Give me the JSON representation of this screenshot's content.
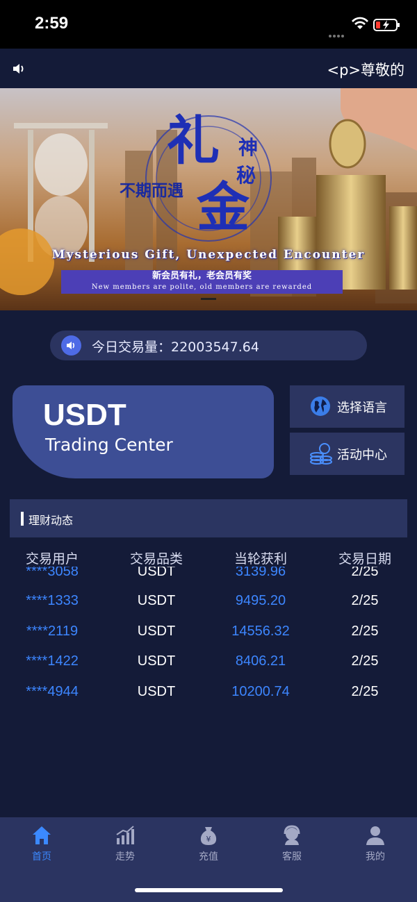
{
  "status_bar": {
    "time": "2:59"
  },
  "notice": {
    "marquee_text": "<p>尊敬的"
  },
  "banner": {
    "heading_cn_small": "不期而遇",
    "heading_cn_li": "礼",
    "heading_cn_shen": "神",
    "heading_cn_mi": "秘",
    "heading_cn_jin": "金",
    "slogan_en": "Mysterious Gift, Unexpected Encounter",
    "strip_cn": "新会员有礼，老会员有奖",
    "strip_en": "New members are polite, old members are rewarded"
  },
  "volume": {
    "label": "今日交易量：22003547.64"
  },
  "card": {
    "title": "USDT",
    "subtitle": "Trading Center"
  },
  "side_buttons": {
    "language": "选择语言",
    "activity": "活动中心"
  },
  "section": {
    "title": "理财动态"
  },
  "table": {
    "headers": [
      "交易用户",
      "交易品类",
      "当轮获利",
      "交易日期"
    ],
    "rows": [
      {
        "user": "****3058",
        "coin": "USDT",
        "profit": "3139.96",
        "date": "2/25"
      },
      {
        "user": "****1333",
        "coin": "USDT",
        "profit": "9495.20",
        "date": "2/25"
      },
      {
        "user": "****2119",
        "coin": "USDT",
        "profit": "14556.32",
        "date": "2/25"
      },
      {
        "user": "****1422",
        "coin": "USDT",
        "profit": "8406.21",
        "date": "2/25"
      },
      {
        "user": "****4944",
        "coin": "USDT",
        "profit": "10200.74",
        "date": "2/25"
      }
    ]
  },
  "tab_bar": {
    "items": [
      {
        "label": "首页",
        "icon": "home-icon",
        "active": true
      },
      {
        "label": "走势",
        "icon": "trend-icon",
        "active": false
      },
      {
        "label": "充值",
        "icon": "yuan-bag-icon",
        "active": false
      },
      {
        "label": "客服",
        "icon": "customer-service-icon",
        "active": false
      },
      {
        "label": "我的",
        "icon": "user-icon",
        "active": false
      }
    ]
  },
  "colors": {
    "background": "#141b38",
    "panel": "#2b3561",
    "card": "#3d4e95",
    "accent_blue": "#3b89ff"
  }
}
